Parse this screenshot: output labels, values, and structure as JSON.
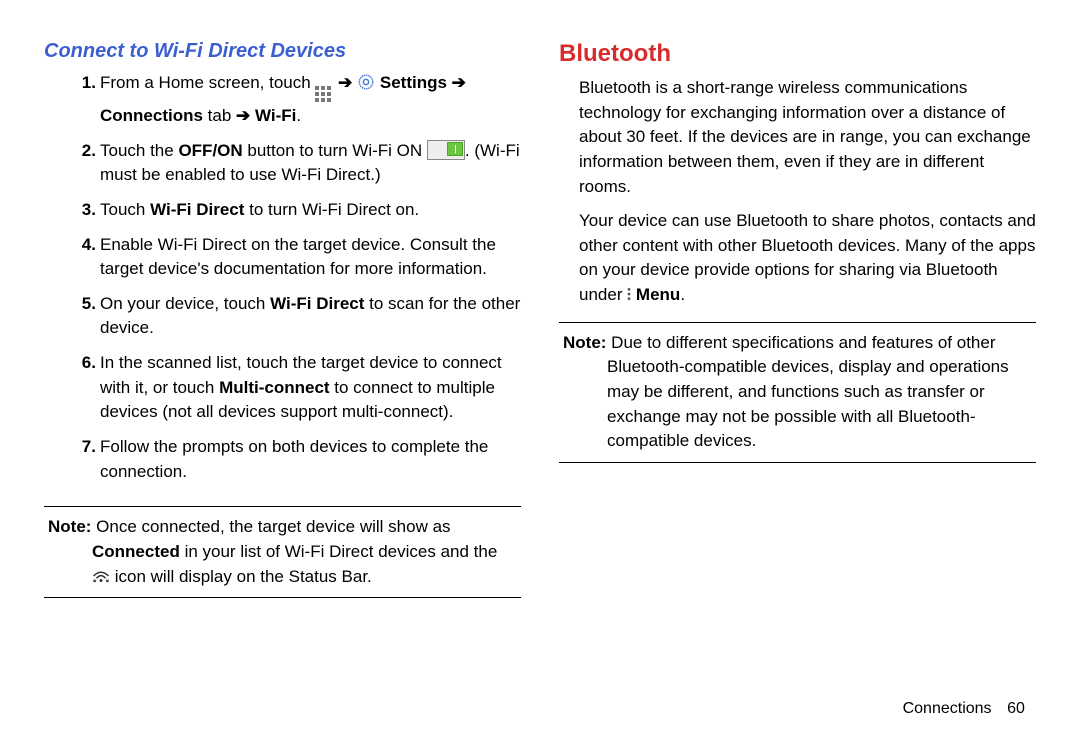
{
  "left": {
    "heading": "Connect to Wi-Fi Direct Devices",
    "step1_a": "From a Home screen, touch ",
    "step1_b": " Settings ",
    "step1_c": "Connections",
    "step1_d": " tab ",
    "step1_e": " Wi-Fi",
    "period": ".",
    "arrow": "➔",
    "step2_a": "Touch the ",
    "step2_off_on": "OFF/ON",
    "step2_b": " button to turn Wi-Fi ON  ",
    "step2_c": ". (Wi-Fi must be enabled to use Wi-Fi Direct.)",
    "step3_a": "Touch ",
    "step3_wfd": "Wi-Fi Direct",
    "step3_b": " to turn Wi-Fi Direct on.",
    "step4": "Enable Wi-Fi Direct on the target device. Consult the target device's documentation for more information.",
    "step5_a": "On your device, touch ",
    "step5_wfd": "Wi-Fi Direct",
    "step5_b": " to scan for the other device.",
    "step6_a": "In the scanned list, touch the target device to connect with it, or touch ",
    "step6_mc": "Multi-connect",
    "step6_b": " to connect to multiple devices (not all devices support multi-connect).",
    "step7": "Follow the prompts on both devices to complete the connection.",
    "note_label": "Note:",
    "note_a": " Once connected, the target device will show as ",
    "note_conn": "Connected",
    "note_b": " in your list of Wi-Fi Direct devices and the ",
    "note_c": " icon will display on the Status Bar."
  },
  "right": {
    "heading": "Bluetooth",
    "p1": "Bluetooth is a short-range wireless communications technology for exchanging information over a distance of about 30 feet. If the devices are in range, you can exchange information between them, even if they are in different rooms.",
    "p2_a": "Your device can use Bluetooth to share photos, contacts and other content with other Bluetooth devices. Many of the apps on your device provide options for sharing via Bluetooth under ",
    "p2_menu": " Menu",
    "note_label": "Note:",
    "note": " Due to different specifications and features of other Bluetooth-compatible devices, display and operations may be different, and functions such as transfer or exchange may not be possible with all Bluetooth-compatible devices."
  },
  "footer": {
    "section": "Connections",
    "page": "60"
  }
}
